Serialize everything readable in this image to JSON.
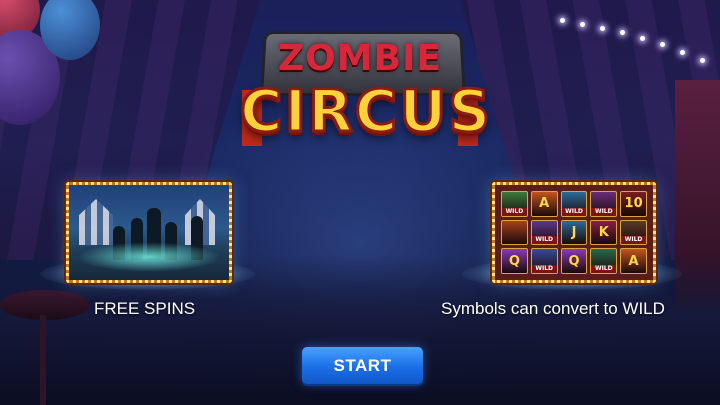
{
  "logo": {
    "line1": "ZOMBIE",
    "line2": "CIRCUS"
  },
  "features": [
    {
      "caption": "FREE SPINS"
    },
    {
      "caption": "Symbols can convert to WILD"
    }
  ],
  "wild_grid": {
    "wild_label": "WILD",
    "cells": [
      {
        "glyph": "",
        "color": "#3b7a3b",
        "wild": true
      },
      {
        "glyph": "A",
        "color": "#c2541d",
        "wild": false
      },
      {
        "glyph": "",
        "color": "#2d6a9a",
        "wild": true
      },
      {
        "glyph": "",
        "color": "#6a2d7a",
        "wild": true
      },
      {
        "glyph": "10",
        "color": "#7a1e1e",
        "wild": false
      },
      {
        "glyph": "",
        "color": "#a8401d",
        "wild": false
      },
      {
        "glyph": "",
        "color": "#5a3a8a",
        "wild": true
      },
      {
        "glyph": "J",
        "color": "#2d6a9a",
        "wild": false
      },
      {
        "glyph": "K",
        "color": "#8a1e4a",
        "wild": false
      },
      {
        "glyph": "",
        "color": "#5a3a2a",
        "wild": true
      },
      {
        "glyph": "Q",
        "color": "#8a3ab0",
        "wild": false
      },
      {
        "glyph": "",
        "color": "#3a4a9a",
        "wild": true
      },
      {
        "glyph": "Q",
        "color": "#8a3ab0",
        "wild": false
      },
      {
        "glyph": "",
        "color": "#2a6a4a",
        "wild": true
      },
      {
        "glyph": "A",
        "color": "#c2541d",
        "wild": false
      }
    ]
  },
  "start_button": {
    "label": "START",
    "color": "#1a6ee6"
  }
}
